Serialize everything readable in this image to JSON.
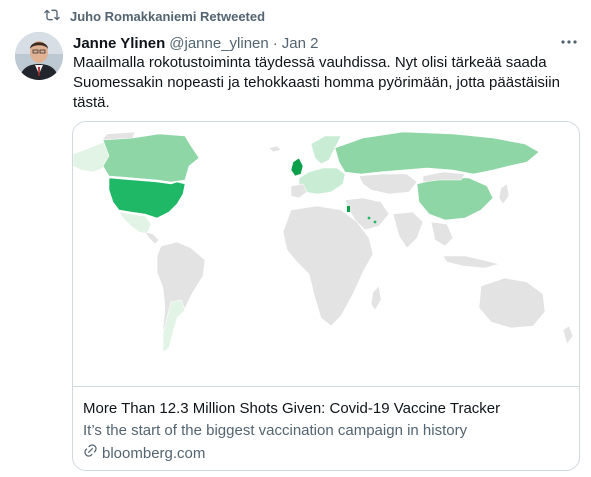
{
  "retweet": {
    "icon": "retweet-icon",
    "label": "Juho Romakkaniemi Retweeted"
  },
  "tweet": {
    "author_name": "Janne Ylinen",
    "author_handle": "@janne_ylinen",
    "separator": "·",
    "date": "Jan 2",
    "text": "Maailmalla rokotustoiminta täydessä vauhdissa. Nyt olisi tärkeää saada Suomessakin nopeasti ja tehokkaasti homma pyörimään, jotta päästäisiin tästä."
  },
  "card": {
    "title": "More Than 12.3 Million Shots Given: Covid-19 Vaccine Tracker",
    "description": "It’s the start of the biggest vaccination campaign in history",
    "domain": "bloomberg.com"
  },
  "colors": {
    "text": "#0f1419",
    "secondary": "#536471",
    "border": "#cfd9de",
    "map_gray": "#e3e3e3",
    "map_darkest": "#0aa04a",
    "map_dark": "#1fb866",
    "map_mid": "#8fd6a7",
    "map_light": "#c9ecd4",
    "map_lightest": "#e1f4e6"
  }
}
